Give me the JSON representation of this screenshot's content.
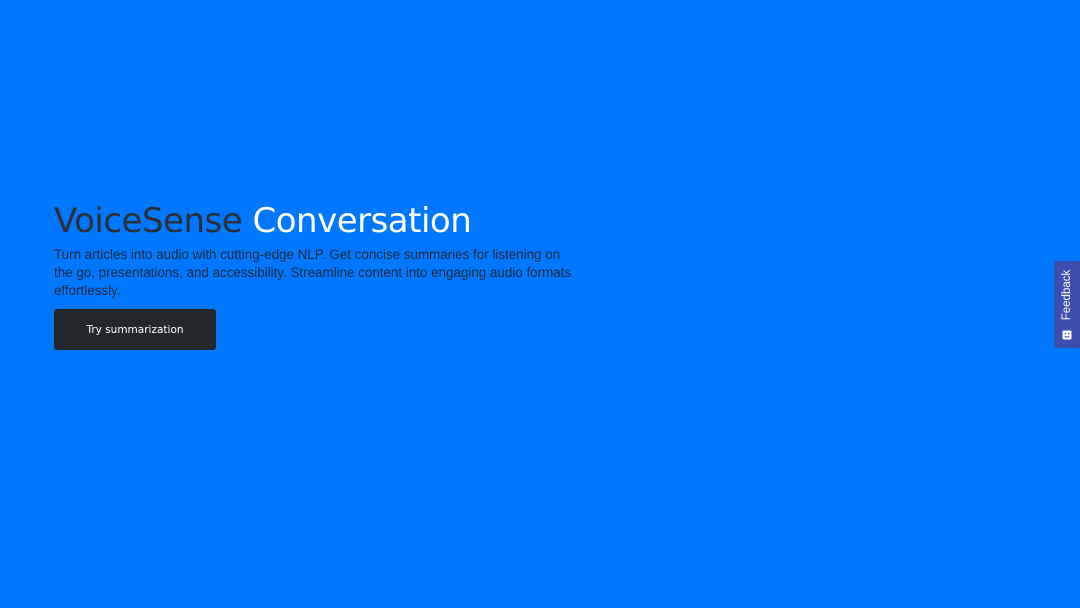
{
  "hero": {
    "brand": "VoiceSense",
    "title_rest": " Conversation",
    "description": "Turn articles into audio with cutting-edge NLP. Get concise summaries for listening on the go, presentations, and accessibility. Streamline content into engaging audio formats effortlessly.",
    "cta_label": "Try summarization"
  },
  "feedback": {
    "label": "Feedback",
    "icon": "smiley-icon"
  },
  "colors": {
    "background": "#0077ff",
    "brand_text": "#2b2f36",
    "button": "#24272c",
    "feedback_tab": "#3d4fae"
  }
}
